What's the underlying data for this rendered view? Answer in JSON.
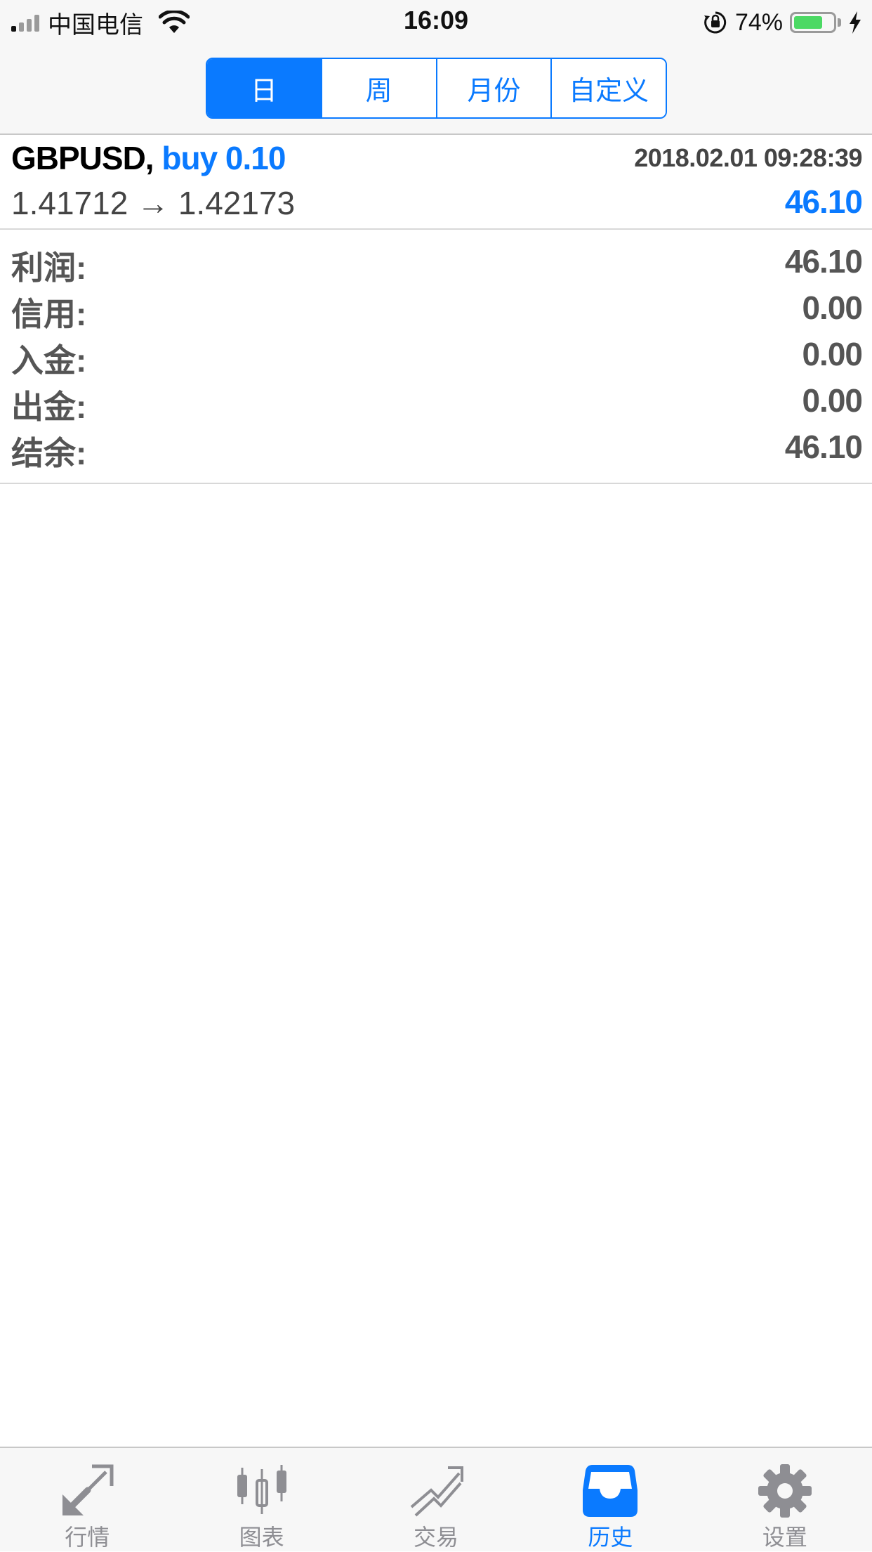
{
  "status_bar": {
    "carrier": "中国电信",
    "time": "16:09",
    "battery_percent": "74%",
    "battery_level": 0.74
  },
  "period_tabs": {
    "items": [
      {
        "label": "日",
        "active": true
      },
      {
        "label": "周",
        "active": false
      },
      {
        "label": "月份",
        "active": false
      },
      {
        "label": "自定义",
        "active": false
      }
    ]
  },
  "deal": {
    "symbol": "GBPUSD,",
    "direction": "buy 0.10",
    "datetime": "2018.02.01 09:28:39",
    "prices": "1.41712 → 1.42173",
    "profit": "46.10"
  },
  "summary": {
    "rows": [
      {
        "label": "利润:",
        "value": "46.10"
      },
      {
        "label": "信用:",
        "value": "0.00"
      },
      {
        "label": "入金:",
        "value": "0.00"
      },
      {
        "label": "出金:",
        "value": "0.00"
      },
      {
        "label": "结余:",
        "value": "46.10"
      }
    ]
  },
  "tab_bar": {
    "items": [
      {
        "label": "行情",
        "icon": "quotes-arrows-icon",
        "active": false
      },
      {
        "label": "图表",
        "icon": "candlestick-chart-icon",
        "active": false
      },
      {
        "label": "交易",
        "icon": "trade-trend-icon",
        "active": false
      },
      {
        "label": "历史",
        "icon": "history-inbox-icon",
        "active": true
      },
      {
        "label": "设置",
        "icon": "gear-icon",
        "active": false
      }
    ]
  },
  "colors": {
    "accent": "#0a7aff",
    "battery": "#4cd964",
    "inactive_tab": "#8e8e93"
  }
}
